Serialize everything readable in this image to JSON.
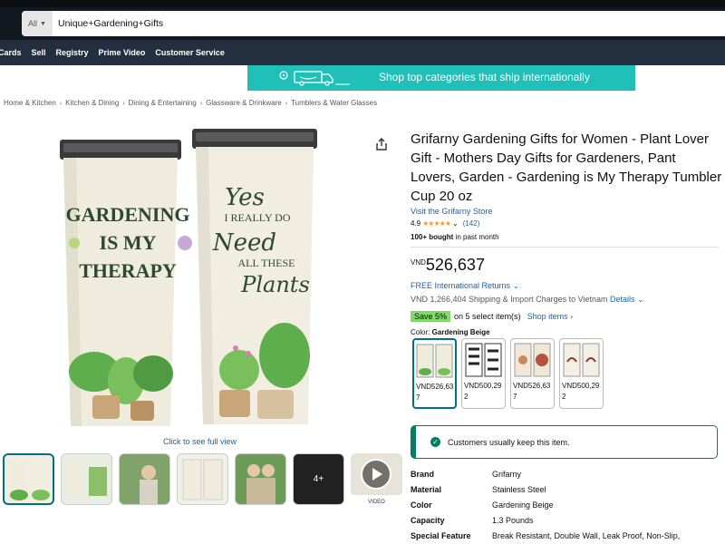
{
  "header": {
    "search_dept": "All",
    "search_value": "Unique+Gardening+Gifts"
  },
  "nav": [
    "Cards",
    "Sell",
    "Registry",
    "Prime Video",
    "Customer Service"
  ],
  "promo": {
    "text": "Shop top categories that ship internationally"
  },
  "breadcrumbs": [
    "Home & Kitchen",
    "Kitchen & Dining",
    "Dining & Entertaining",
    "Glassware & Drinkware",
    "Tumblers & Water Glasses"
  ],
  "gallery": {
    "full_view_link": "Click to see full view",
    "more_count": "4+",
    "video_label": "VIDEO"
  },
  "product": {
    "title": "Grifarny Gardening Gifts for Women - Plant Lover Gift - Mothers Day Gifts for Gardeners, Pant Lovers, Garden - Gardening is My Therapy Tumbler Cup 20 oz",
    "store_link": "Visit the Grifarny Store",
    "rating": "4.9",
    "rating_count": "(142)",
    "bought_bold": "100+ bought",
    "bought_rest": " in past month",
    "price_currency": "VND",
    "price_amount": "526,637",
    "returns": "FREE International Returns",
    "shipping": "VND 1,266,404 Shipping & Import Charges to Vietnam",
    "shipping_details": "Details",
    "save_badge": "Save 5%",
    "save_text": "on 5 select item(s)",
    "shop_items": "Shop items ›",
    "color_label": "Color:",
    "color_value": "Gardening Beige",
    "swatch_prices": [
      "VND526,637",
      "VND500,292",
      "VND526,637",
      "VND500,292"
    ],
    "keep_message": "Customers usually keep this item."
  },
  "specs": [
    {
      "key": "Brand",
      "value": "Grifarny"
    },
    {
      "key": "Material",
      "value": "Stainless Steel"
    },
    {
      "key": "Color",
      "value": "Gardening Beige"
    },
    {
      "key": "Capacity",
      "value": "1.3 Pounds"
    },
    {
      "key": "Special Feature",
      "value": "Break Resistant, Double Wall, Leak Proof, Non-Slip,"
    }
  ],
  "image_text": {
    "left_tumbler": [
      "GARDENING",
      "IS MY",
      "THERAPY"
    ],
    "right_tumbler": [
      "Yes",
      "I REALLY DO",
      "Need",
      "ALL THESE",
      "Plants"
    ]
  },
  "colors": {
    "accent_link": "#2162a1",
    "teal": "#007185",
    "promo": "#20c0b9",
    "save": "#7fda69",
    "nav": "#232f3e",
    "top": "#131921"
  }
}
